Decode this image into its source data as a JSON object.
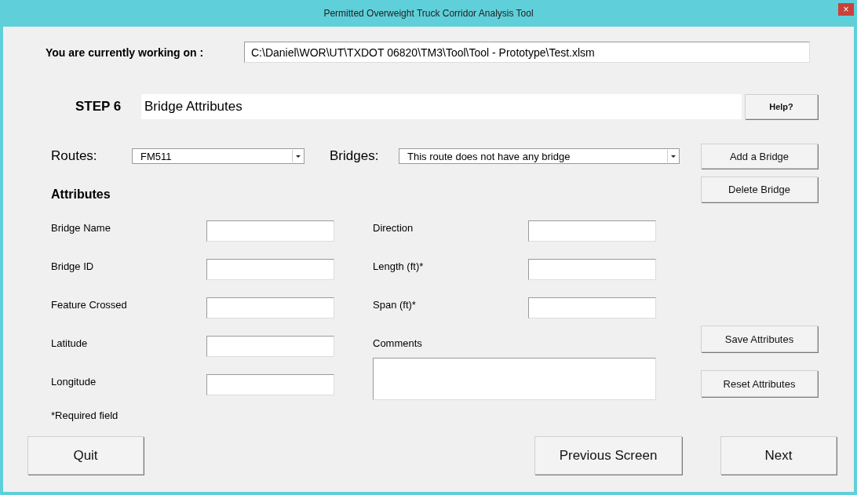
{
  "window": {
    "title": "Permitted Overweight Truck Corridor Analysis Tool",
    "close": "×"
  },
  "file": {
    "label": "You are currently working on :",
    "value": "C:\\Daniel\\WOR\\UT\\TXDOT 06820\\TM3\\Tool\\Tool - Prototype\\Test.xlsm"
  },
  "step": {
    "label": "STEP 6",
    "title": "Bridge Attributes",
    "help": "Help?"
  },
  "routes": {
    "label": "Routes:",
    "value": "FM511"
  },
  "bridges": {
    "label": "Bridges:",
    "value": "This route does not have any bridge"
  },
  "side_buttons": [
    "Add a Bridge",
    "Delete Bridge",
    "Save Attributes",
    "Reset Attributes"
  ],
  "section": "Attributes",
  "fields_left": [
    {
      "label": "Bridge Name",
      "kind": "input"
    },
    {
      "label": "Bridge ID",
      "kind": "input"
    },
    {
      "label": "Feature Crossed",
      "kind": "input"
    },
    {
      "label": "Latitude",
      "kind": "input"
    },
    {
      "label": "Longitude",
      "kind": "input"
    }
  ],
  "fields_right": [
    {
      "label": "Direction",
      "kind": "input"
    },
    {
      "label": "Length (ft)*",
      "kind": "input"
    },
    {
      "label": "Span (ft)*",
      "kind": "input"
    },
    {
      "label": "Comments",
      "kind": "textarea"
    }
  ],
  "note": "*Required field",
  "nav": [
    "Quit",
    "Previous Screen",
    "Next"
  ]
}
